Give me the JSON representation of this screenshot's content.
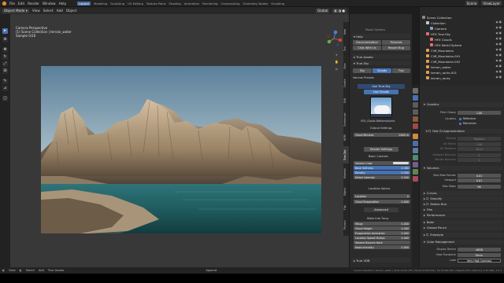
{
  "menubar": {
    "items": [
      "File",
      "Edit",
      "Render",
      "Window",
      "Help"
    ],
    "workspaces": [
      "Layout",
      "Modeling",
      "Sculpting",
      "UV Editing",
      "Texture Paint",
      "Shading",
      "Animation",
      "Rendering",
      "Compositing",
      "Geometry Nodes",
      "Scripting"
    ],
    "scene_label": "Scene",
    "viewlayer_label": "ViewLayer"
  },
  "viewport_header": {
    "mode": "Object Mode",
    "menus": [
      "View",
      "Select",
      "Add",
      "Object"
    ],
    "transform": "Global"
  },
  "viewport_info": {
    "line1": "Camera Perspective",
    "line2": "(1) Scene Collection | terrain_water",
    "line3": "Sample 0/16"
  },
  "vtabs": [
    "Item",
    "Tool",
    "View",
    "Create",
    "Edit",
    "Screencast",
    "HDRI",
    "True-Sky",
    "Material",
    "Object",
    "Flip",
    "Physics"
  ],
  "npanel": {
    "title": "Modal Options",
    "help": "Help",
    "buttons_row1": [
      "Documentation",
      "Tutorials"
    ],
    "buttons_row2": [
      "Chat With Us",
      "Report Bug"
    ],
    "true_assets": "True Assets",
    "true_sky": "True-Sky",
    "sky_tabs": [
      "Sky",
      "Clouds",
      "Fog"
    ],
    "use_true_sky": "Use True-Sky",
    "use_clouds": "Use Clouds",
    "volume_presets": "Volume Presets",
    "preset_name": "GFX_Clouds Bottomvolume",
    "output_settings": "Output Settings",
    "cloud_minutes": "Cloud Minutes",
    "cloud_minutes_val": "2000 m",
    "shader_settings": "Shader Settings",
    "basic_controls": "Basic Controls",
    "basic_rows": [
      {
        "label": "Volume Color",
        "value": ""
      },
      {
        "label": "Base Softness",
        "value": "0.380"
      },
      {
        "label": "Density",
        "value": "0.500"
      },
      {
        "label": "Detail Intensity",
        "value": "0.500"
      }
    ],
    "location_values": "Location Values",
    "location": "Location",
    "location_val": "0",
    "cloud_evaporation": "Cloud Evaporation",
    "cloud_evap_val": "0.000",
    "advanced": "Advanced",
    "make_turvy": "Make Into Turvy",
    "adv_rows": [
      {
        "label": "Wispy",
        "value": "0.000"
      },
      {
        "label": "Cloud Height",
        "value": "0.500"
      },
      {
        "label": "Evaporation Animation",
        "value": "0.000"
      },
      {
        "label": "Location Speed Multipl.",
        "value": "0.000"
      },
      {
        "label": "Volume Bounce Hack",
        "value": ""
      },
      {
        "label": "Haze Intensity",
        "value": "0.000"
      }
    ],
    "true_vdb": "True VDB"
  },
  "outliner": {
    "header": "Scene Collection",
    "items": [
      {
        "name": "Collection",
        "color": "#c9c9c9"
      },
      {
        "name": "Camera",
        "color": "#7f9fcf"
      },
      {
        "name": "HFX True-Sky",
        "color": "#e07070"
      },
      {
        "name": "HFX Clouds",
        "color": "#e07070"
      },
      {
        "name": "HFX World Sphere",
        "color": "#e07070"
      },
      {
        "name": "Cliff_Mountains",
        "color": "#e0a050"
      },
      {
        "name": "Cliff_Mountains.001",
        "color": "#e0a050"
      },
      {
        "name": "Cliff_Mountains.002",
        "color": "#e0a050"
      },
      {
        "name": "terrain_water",
        "color": "#e0a050"
      },
      {
        "name": "terrain_rocks.001",
        "color": "#e0a050"
      },
      {
        "name": "terrain_rocks",
        "color": "#e0a050"
      }
    ]
  },
  "properties": {
    "caustics": "Caustics",
    "filter_glossy": "Filter Glossy",
    "filter_glossy_val": "1.00",
    "caustics_label": "Caustics",
    "reflective": "Reflective",
    "refractive": "Refractive",
    "fast_gi": "Fast GI Approximation",
    "fgi_method": "Method",
    "fgi_method_val": "Replace",
    "fgi_rows": [
      {
        "label": "AO Factor",
        "value": "1.00"
      },
      {
        "label": "AO Distance",
        "value": "10 m"
      },
      {
        "label": "Viewport Bounces",
        "value": "1"
      },
      {
        "label": "Render Bounces",
        "value": "1"
      }
    ],
    "volumes": "Volumes",
    "step_rate_render": "Step Rate Render",
    "step_rate_render_val": "0.01",
    "step_viewport": "Viewport",
    "step_viewport_val": "0.01",
    "max_steps": "Max Steps",
    "max_steps_val": "96",
    "sections": [
      "Curves",
      "Simplify",
      "Motion Blur",
      "Film",
      "Performance",
      "Bake",
      "Grease Pencil",
      "Freestyle",
      "Color Management"
    ],
    "display_device": "Display Device",
    "display_device_val": "sRGB",
    "view_transform": "View Transform",
    "view_transform_val": "Filmic",
    "look": "Look",
    "look_val": "Very High Contrast"
  },
  "status": {
    "items": [
      "View",
      "Select",
      "Add",
      "True Assets"
    ],
    "center": "Append",
    "right": "Scene Collection | terrain_water | Verts 4,032,152 | Faces 8,046,744 | Tris 8,046,744 | Objects 0/11 | Memory 2.43 GiB | 3.3.1"
  }
}
